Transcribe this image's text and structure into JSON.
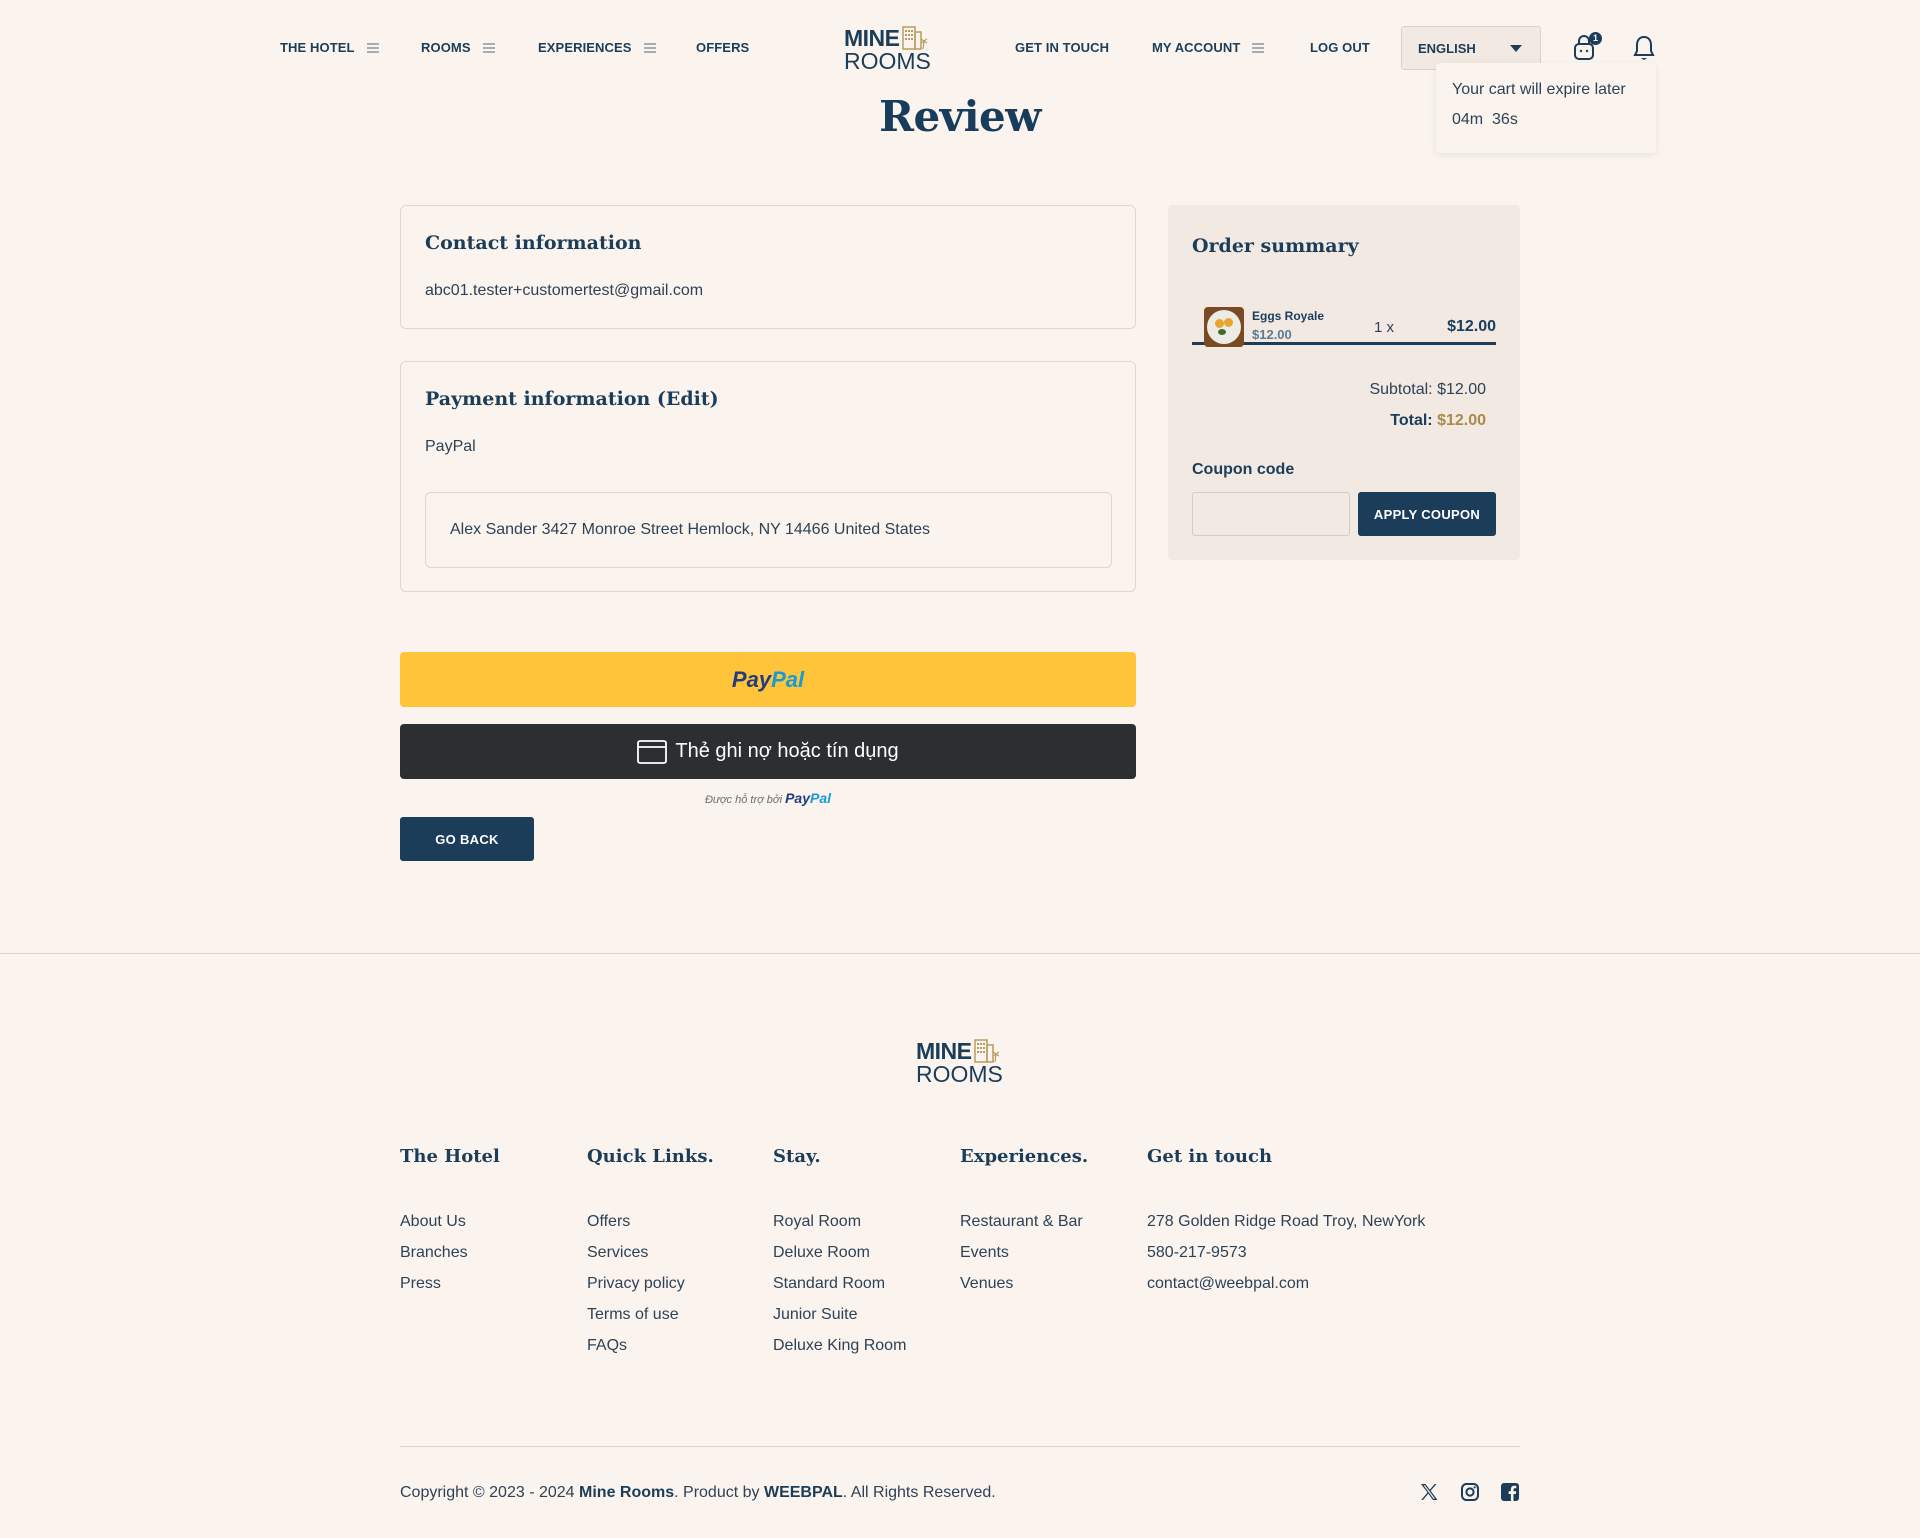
{
  "header": {
    "nav_left": [
      {
        "label": "THE HOTEL",
        "has_menu": true
      },
      {
        "label": "ROOMS",
        "has_menu": true
      },
      {
        "label": "EXPERIENCES",
        "has_menu": true
      },
      {
        "label": "OFFERS",
        "has_menu": false
      }
    ],
    "logo": {
      "line1": "MINE",
      "line2": "ROOMS"
    },
    "nav_right": [
      {
        "label": "GET IN TOUCH",
        "has_menu": false
      },
      {
        "label": "MY ACCOUNT",
        "has_menu": true
      },
      {
        "label": "LOG OUT",
        "has_menu": false
      }
    ],
    "language": "ENGLISH",
    "cart_count": "1",
    "cart_tooltip": {
      "message": "Your cart will expire later",
      "countdown": "04m  36s"
    }
  },
  "page": {
    "title": "Review"
  },
  "contact": {
    "heading": "Contact information",
    "email": "abc01.tester+customertest@gmail.com"
  },
  "payment": {
    "heading": "Payment information (Edit)",
    "method": "PayPal",
    "address": "Alex Sander 3427 Monroe Street Hemlock, NY 14466 United States"
  },
  "paypal_buttons": {
    "paypal_label_1": "Pay",
    "paypal_label_2": "Pal",
    "card_label": "Thẻ ghi nợ hoặc tín dụng",
    "powered_by": "Được hỗ trợ bởi",
    "powered_brand_1": "Pay",
    "powered_brand_2": "Pal"
  },
  "go_back_label": "GO BACK",
  "order_summary": {
    "heading": "Order summary",
    "items": [
      {
        "name": "Eggs Royale",
        "unit_price": "$12.00",
        "quantity": "1 x",
        "line_total": "$12.00"
      }
    ],
    "subtotal_label": "Subtotal:",
    "subtotal_value": "$12.00",
    "total_label": "Total:",
    "total_value": "$12.00",
    "coupon_label": "Coupon code",
    "coupon_value": "",
    "apply_label": "APPLY COUPON"
  },
  "footer": {
    "logo": {
      "line1": "MINE",
      "line2": "ROOMS"
    },
    "columns": [
      {
        "heading": "The Hotel",
        "links": [
          "About Us",
          "Branches",
          "Press"
        ]
      },
      {
        "heading": "Quick Links.",
        "links": [
          "Offers",
          "Services",
          "Privacy policy",
          "Terms of use",
          "FAQs"
        ]
      },
      {
        "heading": "Stay.",
        "links": [
          "Royal Room",
          "Deluxe Room",
          "Standard Room",
          "Junior Suite",
          "Deluxe King Room"
        ]
      },
      {
        "heading": "Experiences.",
        "links": [
          "Restaurant & Bar",
          "Events",
          "Venues"
        ]
      },
      {
        "heading": "Get in touch",
        "links": [
          "278 Golden Ridge Road Troy, NewYork",
          "580-217-9573",
          "contact@weebpal.com"
        ]
      }
    ],
    "copyright_prefix": "Copyright © 2023 - 2024 ",
    "brand": "Mine Rooms",
    "product_by": ". Product by ",
    "company": "WEEBPAL",
    "rights": ". All Rights Reserved.",
    "social": [
      "x-icon",
      "instagram-icon",
      "facebook-icon"
    ]
  },
  "colors": {
    "primary": "#1b3d5a",
    "background": "#fbf4ee",
    "summary_bg": "#f1e9e2",
    "accent_gold": "#a88b4a",
    "paypal_yellow": "#ffc439",
    "card_button": "#2c2e2f"
  }
}
